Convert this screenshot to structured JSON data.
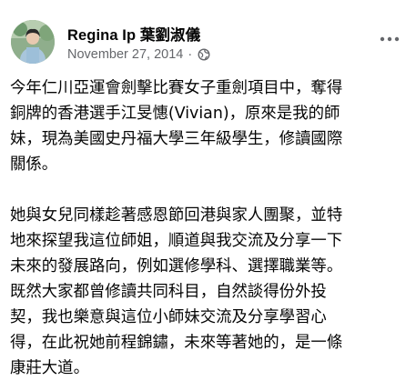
{
  "post": {
    "author": "Regina Ip 葉劉淑儀",
    "date": "November 27, 2014",
    "separator": "·",
    "privacy_icon": "globe-icon",
    "more_icon": "more-options-icon",
    "paragraphs": [
      "今年仁川亞運會劍擊比賽女子重劍項目中，奪得\n銅牌的香港選手江旻憓(Vivian)，原來是我的師\n妹，現為美國史丹福大學三年級學生，修讀國際\n關係。",
      "她與女兒同樣趁著感恩節回港與家人團聚，並特\n地來探望我這位師姐，順道與我交流及分享一下\n未來的發展路向，例如選修學科、選擇職業等。\n既然大家都曾修讀共同科目，自然談得份外投\n契，我也樂意與這位小師妹交流及分享學習心\n得，在此祝她前程錦鏽，未來等著她的，是一條\n康莊大道。"
    ]
  },
  "colors": {
    "text_primary": "#050505",
    "text_secondary": "#65676b",
    "background": "#ffffff"
  }
}
